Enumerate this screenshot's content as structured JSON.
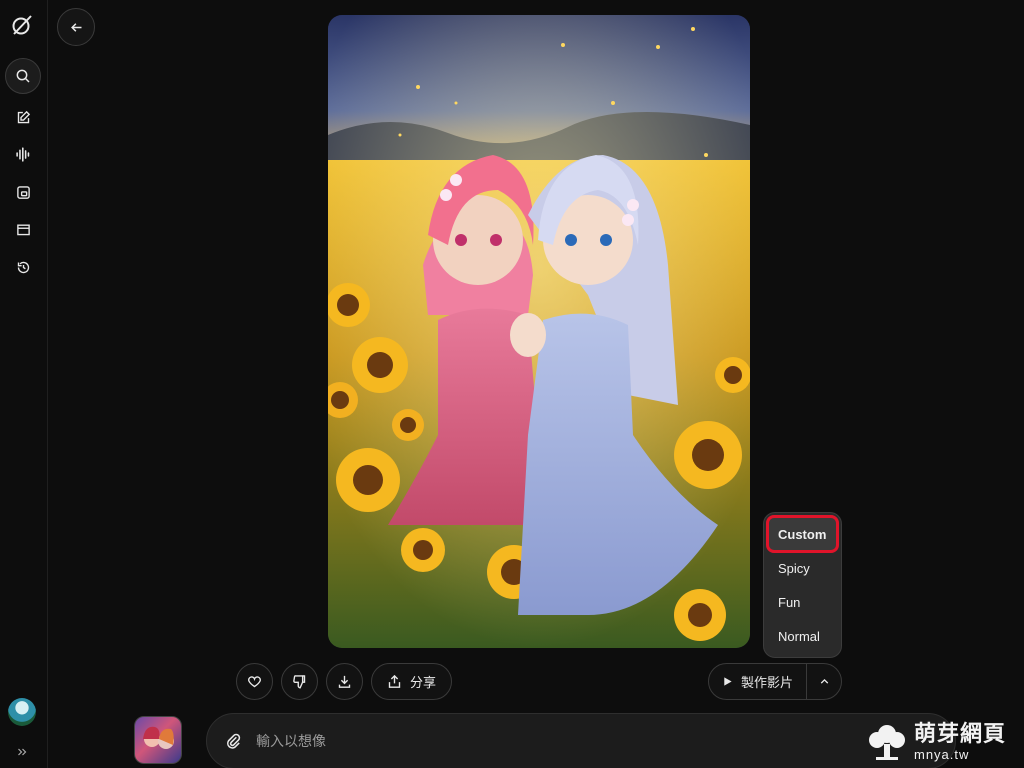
{
  "sidebar": {
    "items": [
      {
        "icon": "search-icon"
      },
      {
        "icon": "edit-icon"
      },
      {
        "icon": "voice-icon"
      },
      {
        "icon": "imagine-icon"
      },
      {
        "icon": "projects-icon"
      },
      {
        "icon": "history-icon"
      }
    ]
  },
  "actions": {
    "share_label": "分享",
    "make_video_label": "製作影片"
  },
  "video_mode_menu": {
    "options": [
      "Custom",
      "Spicy",
      "Fun",
      "Normal"
    ],
    "selected": "Custom"
  },
  "composer": {
    "placeholder": "輸入以想像"
  },
  "watermark": {
    "name": "萌芽網頁",
    "domain": "mnya.tw"
  },
  "colors": {
    "background": "#0d0d0d",
    "highlight": "#e0142a",
    "menu_bg": "#2a2a2a"
  }
}
